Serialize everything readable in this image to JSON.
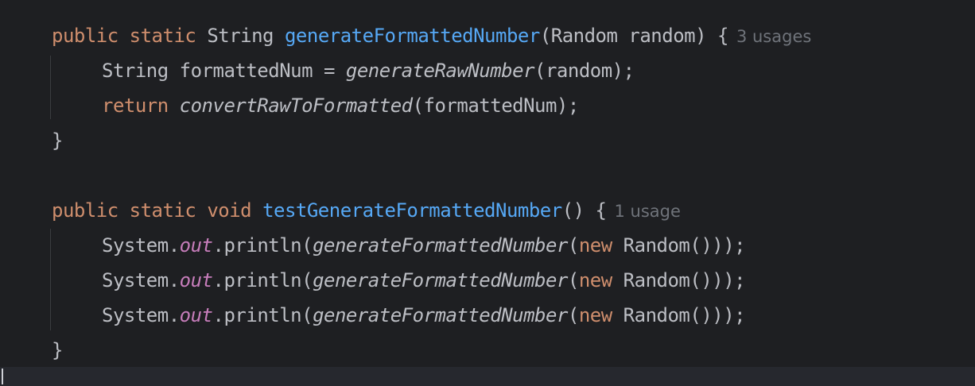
{
  "code": {
    "line1": {
      "kw_public": "public",
      "kw_static": "static",
      "type": "String",
      "method_name": "generateFormattedNumber",
      "params": "(Random random) {",
      "usage_hint": "3 usages"
    },
    "line2": {
      "decl": "String formattedNum = ",
      "call": "generateRawNumber",
      "args": "(random);"
    },
    "line3": {
      "kw_return": "return",
      "call": "convertRawToFormatted",
      "args": "(formattedNum);"
    },
    "line4": {
      "brace": "}"
    },
    "line5": {
      "kw_public": "public",
      "kw_static": "static",
      "kw_void": "void",
      "method_name": "testGenerateFormattedNumber",
      "params": "() {",
      "usage_hint": "1 usage"
    },
    "print_line": {
      "system": "System.",
      "field": "out",
      "println": ".println(",
      "call": "generateFormattedNumber",
      "open": "(",
      "kw_new": "new",
      "tail": " Random()));"
    },
    "line9": {
      "brace": "}"
    }
  },
  "colors": {
    "background": "#1e1f22",
    "keyword": "#cf8e6d",
    "method_declaration": "#56a8f5",
    "static_field": "#c77dbb",
    "default_text": "#bcbec4",
    "inlay_hint": "#6f737a"
  }
}
